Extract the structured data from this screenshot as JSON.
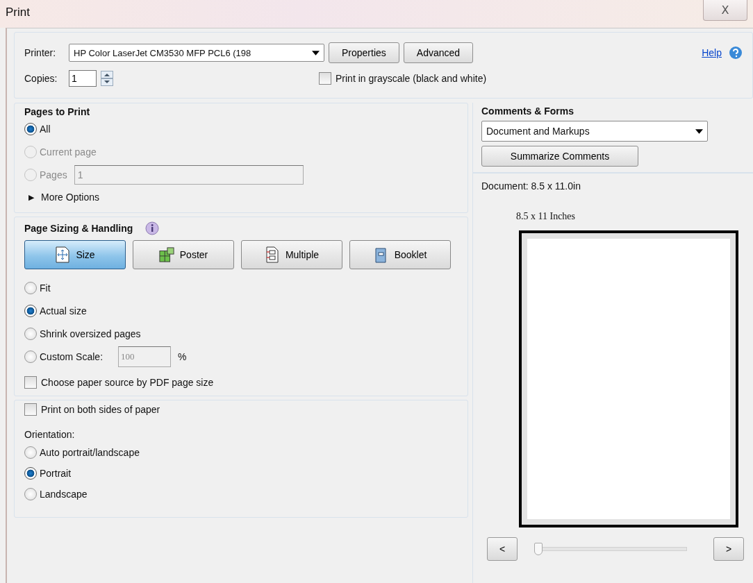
{
  "window": {
    "title": "Print",
    "close_label": "X"
  },
  "printer": {
    "label": "Printer:",
    "value": "HP Color LaserJet CM3530 MFP PCL6 (198",
    "buttons": [
      "Properties",
      "Advanced"
    ]
  },
  "help": {
    "label": "Help"
  },
  "copies": {
    "label": "Copies:",
    "value": "1"
  },
  "grayscale": {
    "label": "Print in grayscale (black and white)",
    "checked": false
  },
  "pages_to_print": {
    "title": "Pages to Print",
    "options": [
      {
        "label": "All",
        "selected": true,
        "disabled": false
      },
      {
        "label": "Current page",
        "selected": false,
        "disabled": true
      },
      {
        "label": "Pages",
        "selected": false,
        "disabled": true,
        "field": "1"
      }
    ],
    "more_options": "More Options",
    "expander": "▶"
  },
  "page_sizing": {
    "title": "Page Sizing & Handling",
    "modes": [
      {
        "label": "Size",
        "kind": "size",
        "selected": true
      },
      {
        "label": "Poster",
        "kind": "poster",
        "selected": false
      },
      {
        "label": "Multiple",
        "kind": "multiple",
        "selected": false
      },
      {
        "label": "Booklet",
        "kind": "booklet",
        "selected": false
      }
    ],
    "options": [
      {
        "label": "Fit",
        "selected": false
      },
      {
        "label": "Actual size",
        "selected": true
      },
      {
        "label": "Shrink oversized pages",
        "selected": false
      },
      {
        "label": "Custom Scale:",
        "selected": false,
        "field": "100",
        "unit": "%"
      }
    ],
    "paper_source": {
      "label": "Choose paper source by PDF page size",
      "checked": false
    }
  },
  "duplex": {
    "label": "Print on both sides of paper",
    "checked": false
  },
  "orientation": {
    "title": "Orientation:",
    "options": [
      {
        "label": "Auto portrait/landscape",
        "selected": false
      },
      {
        "label": "Portrait",
        "selected": true
      },
      {
        "label": "Landscape",
        "selected": false
      }
    ]
  },
  "comments_forms": {
    "title": "Comments & Forms",
    "value": "Document and Markups",
    "button": "Summarize Comments"
  },
  "preview": {
    "document": "Document: 8.5 x 11.0in",
    "page_size": "8.5 x 11 Inches",
    "prev": "<",
    "next": ">",
    "slider": {
      "level": 0
    }
  }
}
